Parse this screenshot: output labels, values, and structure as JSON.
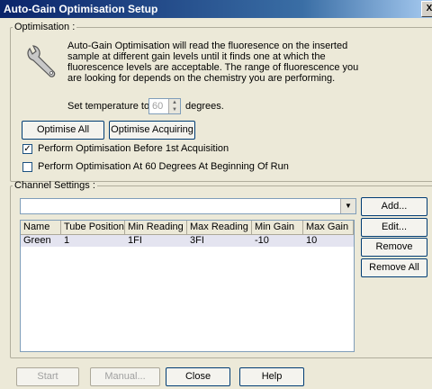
{
  "window": {
    "title": "Auto-Gain Optimisation Setup",
    "close_glyph": "X"
  },
  "optimisation": {
    "legend": "Optimisation :",
    "description": "Auto-Gain Optimisation will read the fluoresence on the inserted sample at different gain levels until it finds one at which the fluorescence levels are acceptable. The range of fluorescence you are looking for depends on the chemistry you are performing.",
    "temp_prefix": "Set temperature to",
    "temp_value": "60",
    "temp_suffix": "degrees.",
    "optimise_all": "Optimise All",
    "optimise_acquiring": "Optimise Acquiring",
    "checkbox1_label": "Perform Optimisation Before 1st Acquisition",
    "checkbox1_checked": true,
    "checkbox2_label": "Perform Optimisation At 60 Degrees At Beginning Of Run",
    "checkbox2_checked": false
  },
  "channel_settings": {
    "legend": "Channel Settings :",
    "combo_value": "",
    "columns": [
      "Name",
      "Tube Position",
      "Min Reading",
      "Max Reading",
      "Min Gain",
      "Max Gain"
    ],
    "rows": [
      [
        "Green",
        "1",
        "1FI",
        "3FI",
        "-10",
        "10"
      ]
    ],
    "add": "Add...",
    "edit": "Edit...",
    "remove": "Remove",
    "remove_all": "Remove All"
  },
  "footer": {
    "start": "Start",
    "manual": "Manual...",
    "close": "Close",
    "help": "Help"
  }
}
